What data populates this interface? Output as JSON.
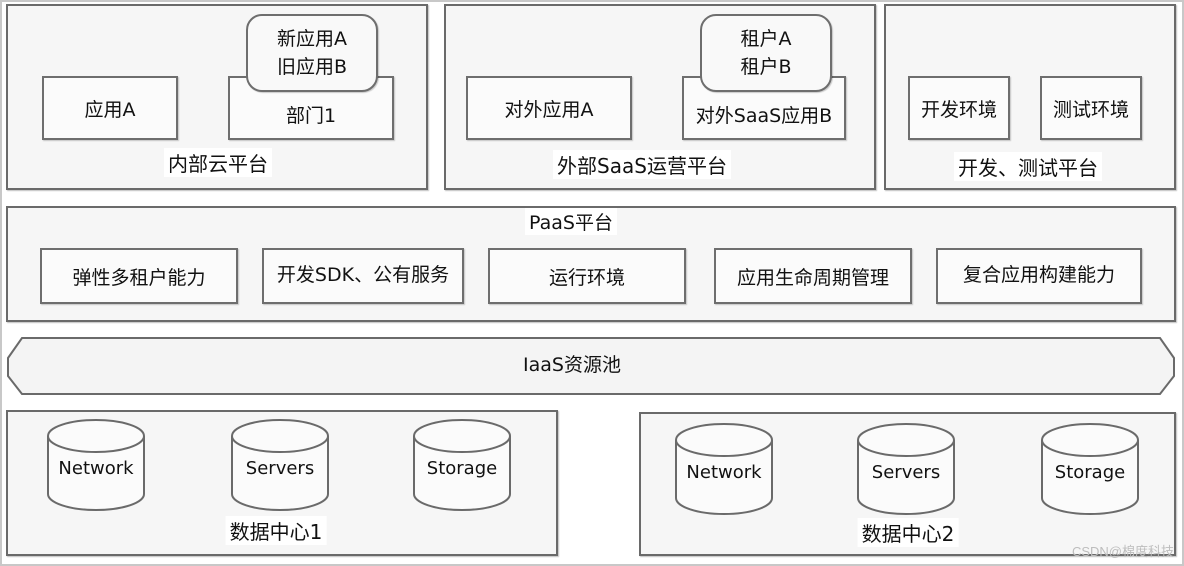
{
  "top_row": {
    "internal_cloud": {
      "title": "内部云平台",
      "app_box": "应用A",
      "dept_box": "部门1",
      "dept_apps": [
        "新应用A",
        "旧应用B"
      ]
    },
    "external_saas": {
      "title": "外部SaaS运营平台",
      "app_box": "对外应用A",
      "saas_box": "对外SaaS应用B",
      "tenants": [
        "租户A",
        "租户B"
      ]
    },
    "dev_test": {
      "title": "开发、测试平台",
      "dev_env": "开发环境",
      "test_env": "测试环境"
    }
  },
  "paas": {
    "title": "PaaS平台",
    "capabilities": [
      "弹性多租户能力",
      "开发SDK、公有服务",
      "运行环境",
      "应用生命周期管理",
      "复合应用构建能力"
    ]
  },
  "iaas": {
    "title": "IaaS资源池"
  },
  "datacenters": [
    {
      "title": "数据中心1",
      "resources": [
        "Network",
        "Servers",
        "Storage"
      ]
    },
    {
      "title": "数据中心2",
      "resources": [
        "Network",
        "Servers",
        "Storage"
      ]
    }
  ],
  "watermark": "CSDN@棉度科技"
}
